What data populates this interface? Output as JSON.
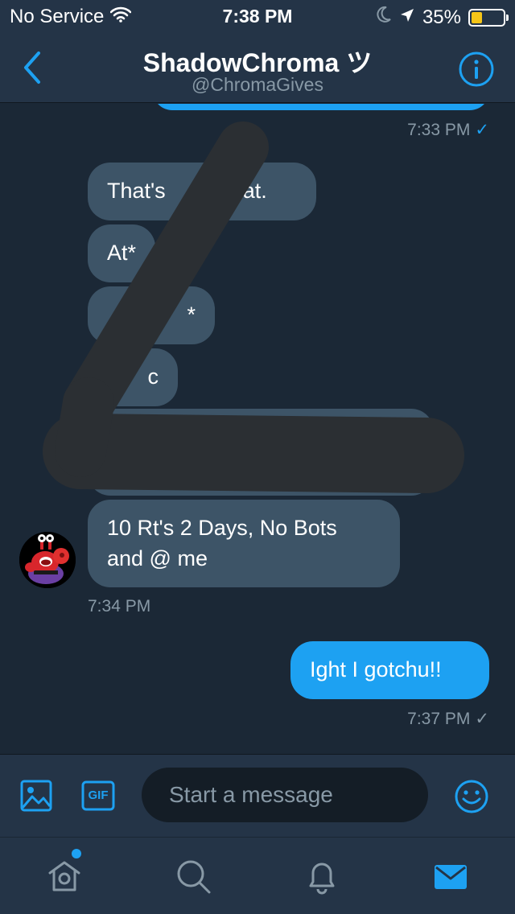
{
  "status_bar": {
    "carrier": "No Service",
    "time": "7:38 PM",
    "battery_percent": "35%",
    "battery_level": 0.35,
    "icons": [
      "wifi-icon",
      "moon-icon",
      "location-arrow-icon",
      "battery-icon"
    ]
  },
  "header": {
    "title": "ShadowChroma ツ",
    "handle": "@ChromaGives",
    "back_icon": "chevron-left-icon",
    "info_icon": "info-icon"
  },
  "conversation": {
    "messages": [
      {
        "direction": "outgoing",
        "text": "",
        "time": "7:33 PM",
        "status": "✓"
      },
      {
        "direction": "incoming",
        "text": "That's"
      },
      {
        "direction": "incoming",
        "text": "at."
      },
      {
        "direction": "incoming",
        "text": "At*"
      },
      {
        "direction": "incoming",
        "text": "*"
      },
      {
        "direction": "incoming",
        "text": "c"
      },
      {
        "direction": "incoming",
        "text": ""
      },
      {
        "direction": "incoming",
        "text_line1": "10 Rt's 2 Days, No Bots",
        "text_line2": "and @ me",
        "time": "7:34 PM"
      },
      {
        "direction": "outgoing",
        "text": "Ight I gotchu!!",
        "time": "7:37 PM",
        "status": "✓"
      }
    ]
  },
  "composer": {
    "placeholder": "Start a message",
    "buttons": [
      "image-icon",
      "gif-icon",
      "emoji-icon"
    ],
    "gif_label": "GIF"
  },
  "tab_bar": {
    "tabs": [
      "home-icon",
      "search-icon",
      "bell-icon",
      "mail-icon"
    ],
    "active": "mail-icon",
    "home_has_notification": true
  },
  "colors": {
    "background": "#1b2836",
    "bar": "#243447",
    "incoming_bubble": "#3d5467",
    "outgoing_bubble": "#1da1f2",
    "accent": "#1da1f2",
    "muted_text": "#8899a6",
    "battery": "#f5c518"
  }
}
